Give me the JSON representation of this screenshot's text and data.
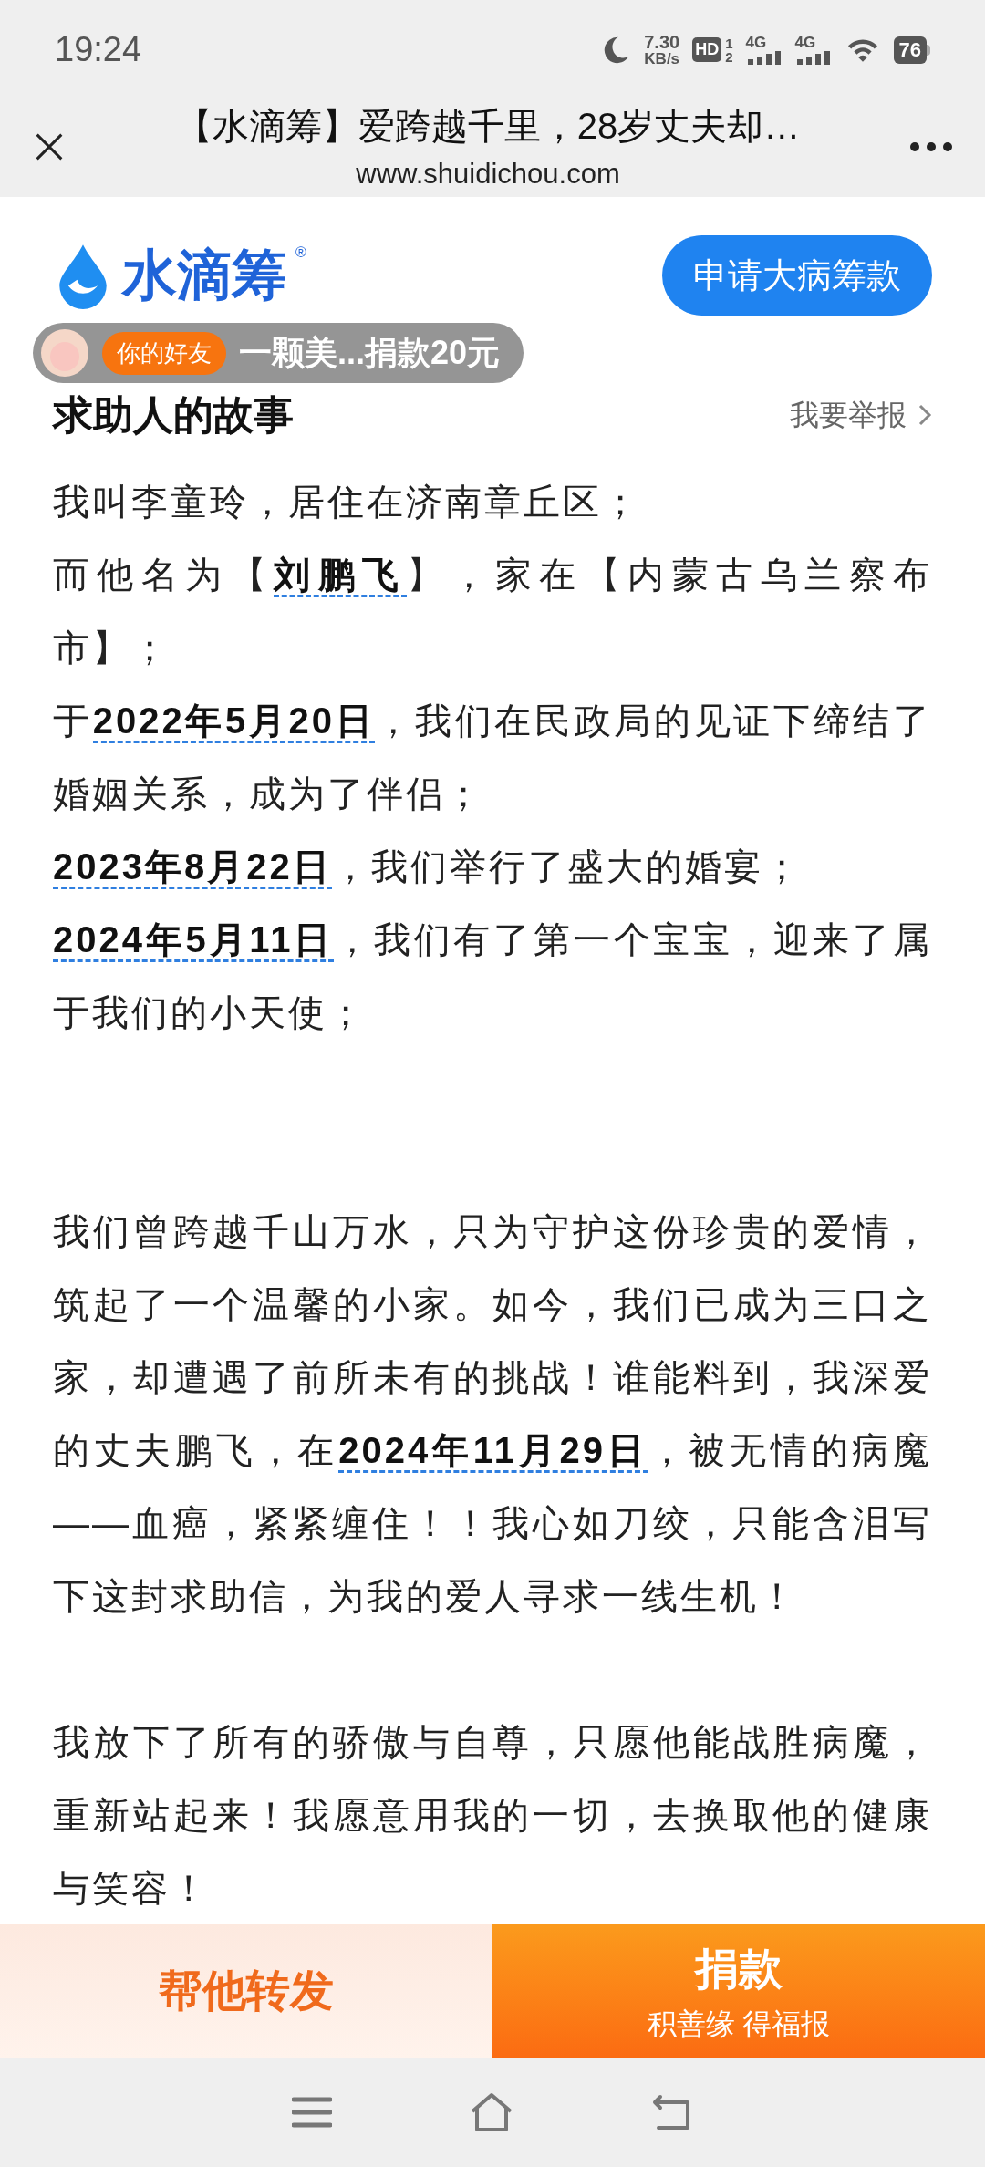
{
  "status_bar": {
    "time": "19:24",
    "speed_value": "7.30",
    "speed_unit": "KB/s",
    "hd": "HD",
    "sim_1": "1",
    "sim_2": "2",
    "net_1": "4G",
    "net_2": "4G",
    "battery": "76"
  },
  "header": {
    "title": "【水滴筹】爱跨越千里，28岁丈夫却…",
    "url": "www.shuidichou.com"
  },
  "brand": {
    "name": "水滴筹",
    "registered": "®",
    "apply_button": "申请大病筹款"
  },
  "toast": {
    "tag": "你的好友",
    "text": "一颗美...捐款20元"
  },
  "story": {
    "title": "求助人的故事",
    "report_link": "我要举报",
    "sections": [
      [
        "我叫李童玲，居住在济南章丘区；",
        "而他名为【**刘鹏飞**】，家在【内蒙古乌兰察布市】；",
        "于**2022年5月20日**，我们在民政局的见证下缔结了婚姻关系，成为了伴侣；",
        "**2023年8月22日**，我们举行了盛大的婚宴；",
        "**2024年5月11日**，我们有了第一个宝宝，迎来了属于我们的小天使；"
      ],
      [
        "我们曾跨越千山万水，只为守护这份珍贵的爱情，筑起了一个温馨的小家。如今，我们已成为三口之家，却遭遇了前所未有的挑战！谁能料到，我深爱的丈夫鹏飞，在**2024年11月29日**，被无情的病魔——血癌，紧紧缠住！！我心如刀绞，只能含泪写下这封求助信，为我的爱人寻求一线生机！"
      ],
      [
        "我放下了所有的骄傲与自尊，只愿他能战胜病魔，重新站起来！我愿意用我的一切，去换取他的健康与笑容！"
      ]
    ]
  },
  "actions": {
    "share": "帮他转发",
    "donate": "捐款",
    "donate_sub": "积善缘 得福报"
  }
}
